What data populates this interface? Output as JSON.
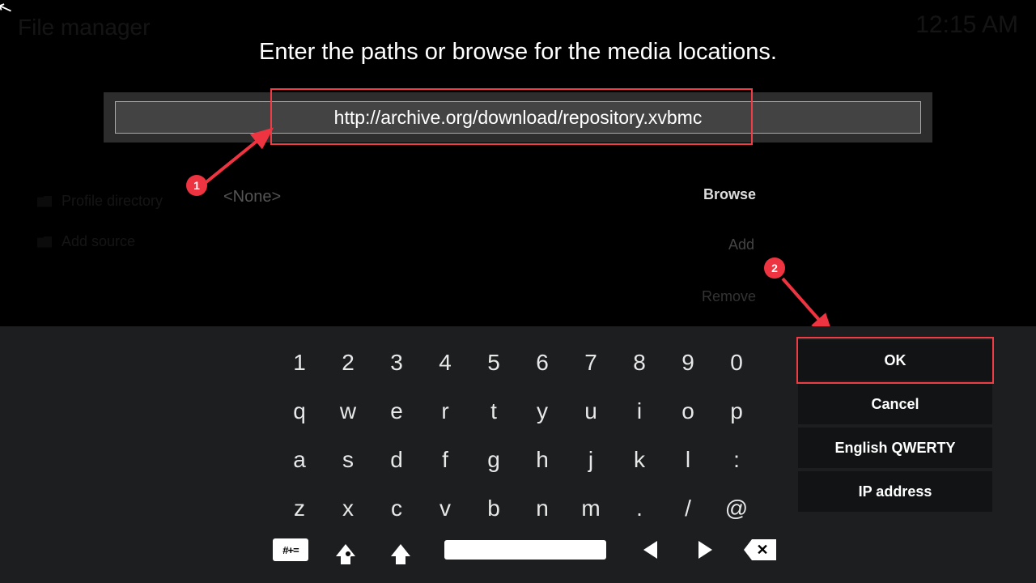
{
  "background": {
    "title": "File manager",
    "clock": "12:15 AM",
    "items": [
      "Profile directory",
      "Add source"
    ]
  },
  "dialog": {
    "title": "Enter the paths or browse for the media locations.",
    "input_value": "http://archive.org/download/repository.xvbmc",
    "none_label": "<None>",
    "browse": "Browse",
    "add": "Add",
    "remove": "Remove"
  },
  "annotations": {
    "badge1": "1",
    "badge2": "2",
    "colors": {
      "highlight": "#ef3d45"
    }
  },
  "keyboard": {
    "rows": [
      [
        "1",
        "2",
        "3",
        "4",
        "5",
        "6",
        "7",
        "8",
        "9",
        "0"
      ],
      [
        "q",
        "w",
        "e",
        "r",
        "t",
        "y",
        "u",
        "i",
        "o",
        "p"
      ],
      [
        "a",
        "s",
        "d",
        "f",
        "g",
        "h",
        "j",
        "k",
        "l",
        ":"
      ],
      [
        "z",
        "x",
        "c",
        "v",
        "b",
        "n",
        "m",
        ".",
        "/",
        "@"
      ]
    ],
    "symbols_label": "#+="
  },
  "actions": {
    "ok": "OK",
    "cancel": "Cancel",
    "layout": "English QWERTY",
    "ip": "IP address"
  }
}
